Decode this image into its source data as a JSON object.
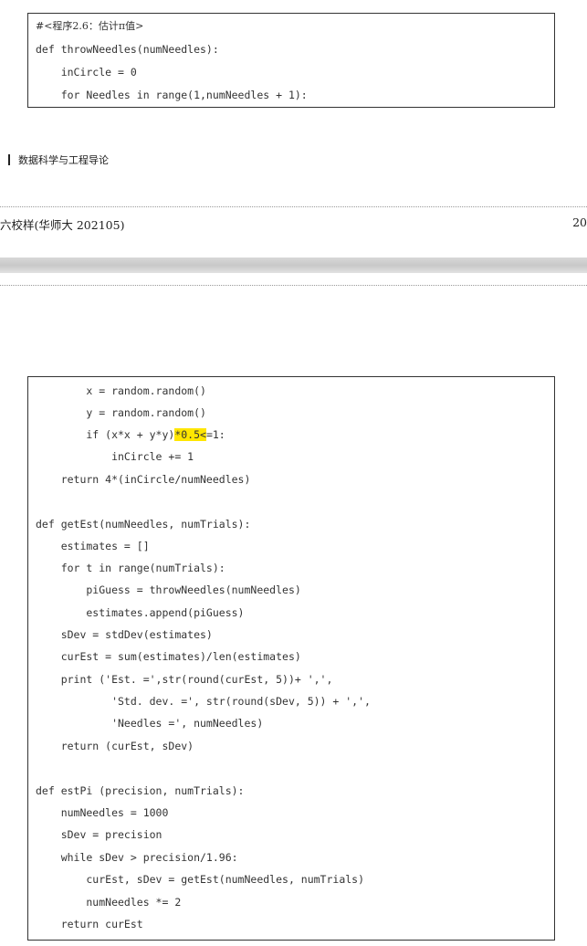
{
  "box1": {
    "lines": [
      "#<程序2.6：估计π值>",
      "def throwNeedles(numNeedles):",
      "    inCircle = 0",
      "    for Needles in range(1,numNeedles + 1):"
    ]
  },
  "chapter_header": "数据科学与工程导论",
  "footer": {
    "left": "六校样(华师大 202105)",
    "right": "20"
  },
  "box2": {
    "line0": "        x = random.random()",
    "line1": "        y = random.random()",
    "line2_pre": "        if (x*x + y*y)",
    "line2_hl": "*0.5<",
    "line2_post": "=1:",
    "line3": "            inCircle += 1",
    "line4": "    return 4*(inCircle/numNeedles)",
    "line5": "def getEst(numNeedles, numTrials):",
    "line6": "    estimates = []",
    "line7": "    for t in range(numTrials):",
    "line8": "        piGuess = throwNeedles(numNeedles)",
    "line9": "        estimates.append(piGuess)",
    "line10": "    sDev = stdDev(estimates)",
    "line11": "    curEst = sum(estimates)/len(estimates)",
    "line12": "    print ('Est. =',str(round(curEst, 5))+ ',',",
    "line13": "            'Std. dev. =', str(round(sDev, 5)) + ',',",
    "line14": "            'Needles =', numNeedles)",
    "line15": "    return (curEst, sDev)",
    "line16": "def estPi (precision, numTrials):",
    "line17": "    numNeedles = 1000",
    "line18": "    sDev = precision",
    "line19": "    while sDev > precision/1.96:",
    "line20": "        curEst, sDev = getEst(numNeedles, numTrials)",
    "line21": "        numNeedles *= 2",
    "line22": "    return curEst"
  },
  "colors": {
    "highlight": "#ffe600",
    "border": "#333333"
  }
}
